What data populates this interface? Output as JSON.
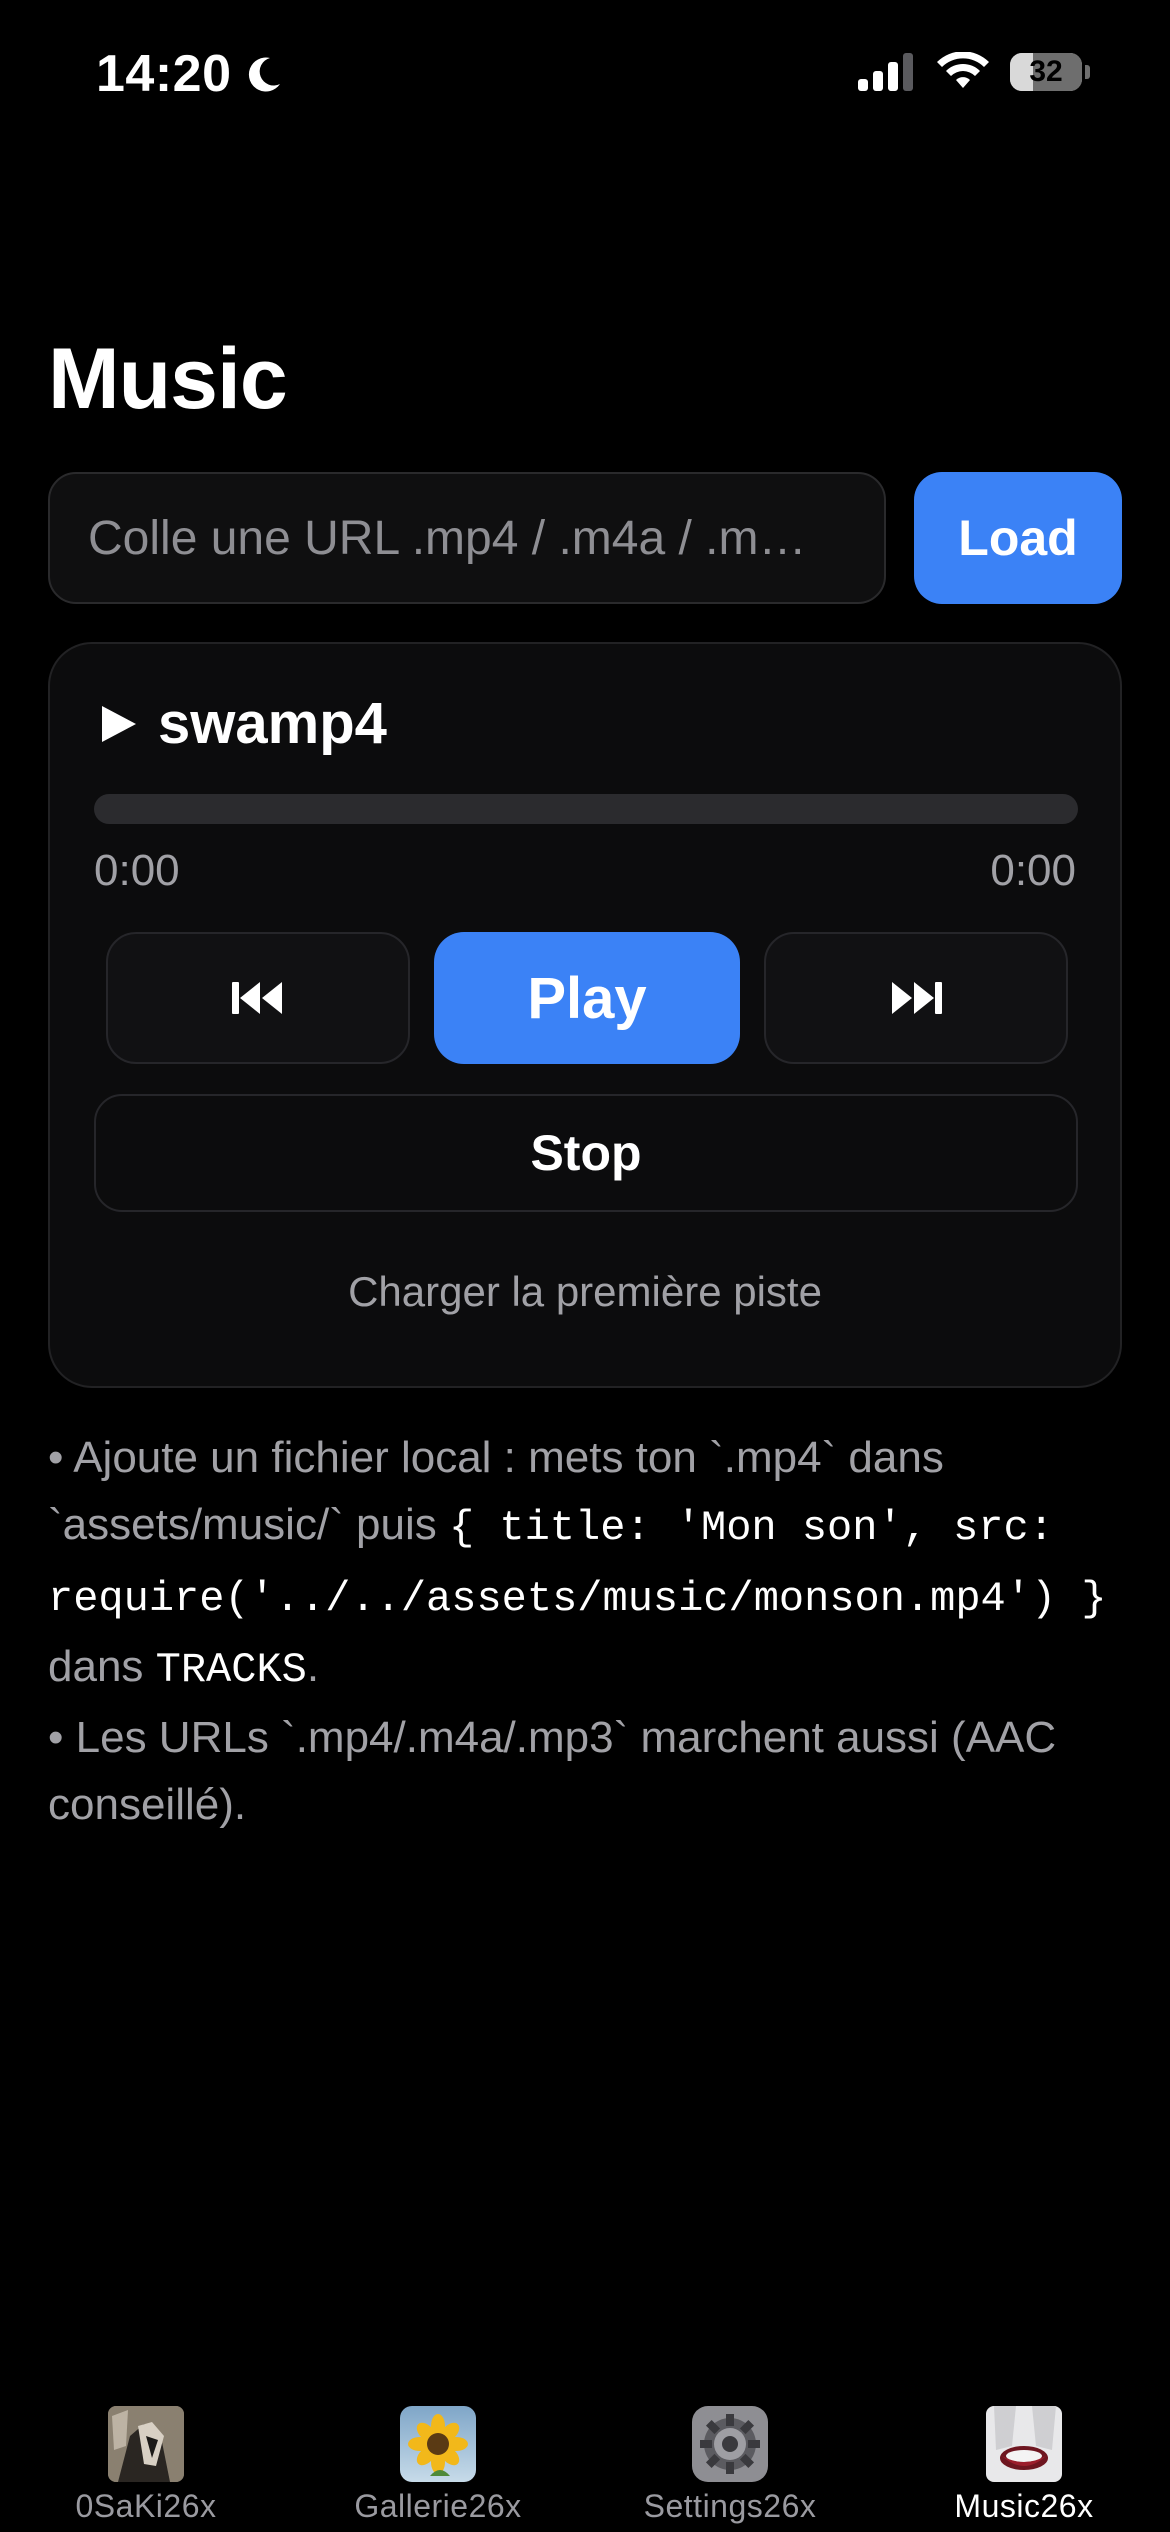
{
  "status_bar": {
    "time": "14:20",
    "moon_icon": "moon-icon",
    "signal_icon": "cellular-signal-icon",
    "wifi_icon": "wifi-icon",
    "battery_level": 32,
    "battery_label": "32"
  },
  "page": {
    "title": "Music"
  },
  "url_bar": {
    "placeholder": "Colle une URL .mp4 / .m4a / .m…",
    "value": "",
    "load_label": "Load"
  },
  "player": {
    "play_indicator_icon": "play-triangle-icon",
    "track_name": "swamp4",
    "progress": 0,
    "time_current": "0:00",
    "time_total": "0:00",
    "prev_icon": "skip-previous-icon",
    "play_label": "Play",
    "next_icon": "skip-next-icon",
    "stop_label": "Stop",
    "load_first_label": "Charger la première piste"
  },
  "help": {
    "line1_a": "• Ajoute un fichier local : mets ton `.mp4` dans `assets/music/` puis ",
    "line1_code": "{ title: 'Mon son', src: require('../../assets/music/monson.mp4') }",
    "line1_b": " dans ",
    "line1_tracks": "TRACKS",
    "line1_c": ".",
    "line2": "• Les URLs `.mp4/.m4a/.mp3` marchent aussi (AAC conseillé)."
  },
  "tabs": [
    {
      "label": "0SaKi26x",
      "icon": "osaki-avatar-icon",
      "active": false
    },
    {
      "label": "Gallerie26x",
      "icon": "sunflower-gallery-icon",
      "active": false
    },
    {
      "label": "Settings26x",
      "icon": "settings-gear-icon",
      "active": false
    },
    {
      "label": "Music26x",
      "icon": "music-face-icon",
      "active": true
    }
  ],
  "colors": {
    "accent": "#3b82f6",
    "background": "#000000",
    "card": "#0c0c0d",
    "muted_text": "#a1a1a6"
  }
}
